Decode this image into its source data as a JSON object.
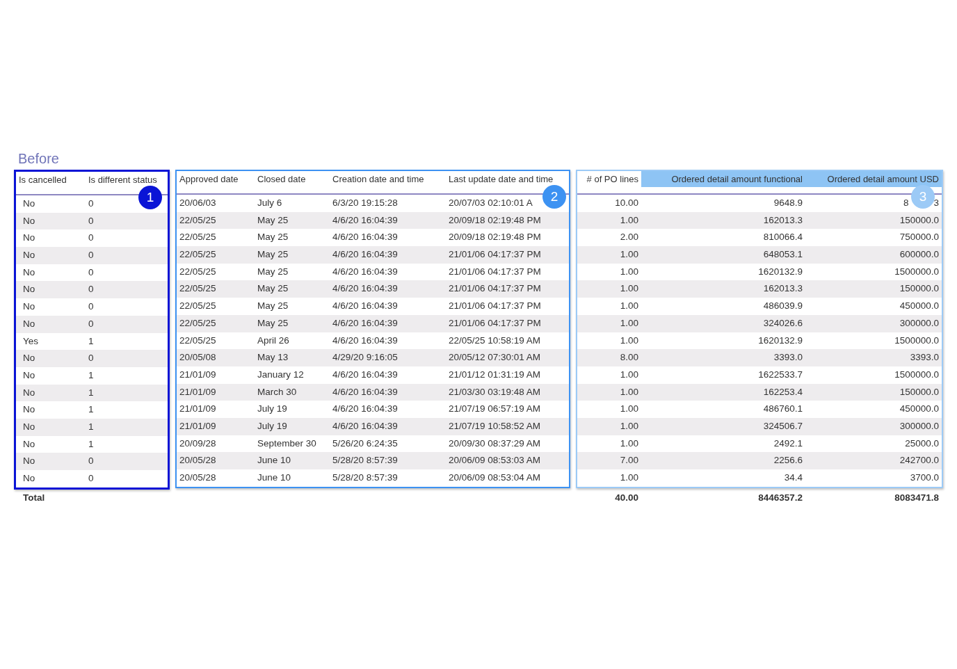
{
  "title": "Before",
  "groups": [
    {
      "badge": "1",
      "color": "#0a14d6",
      "kind": "text",
      "columns": [
        {
          "label": "Is cancelled",
          "highlighted": false
        },
        {
          "label": "Is different status",
          "highlighted": false
        }
      ]
    },
    {
      "badge": "2",
      "color": "#3d92f2",
      "kind": "text",
      "columns": [
        {
          "label": "Approved date",
          "highlighted": false
        },
        {
          "label": "Closed date",
          "highlighted": false
        },
        {
          "label": "Creation date and time",
          "highlighted": false
        },
        {
          "label": "Last update date and time",
          "highlighted": false
        }
      ]
    },
    {
      "badge": "3",
      "color": "#9ccaf6",
      "kind": "numeric",
      "columns": [
        {
          "label": "# of PO lines",
          "highlighted": false
        },
        {
          "label": "Ordered detail amount functional",
          "highlighted": true
        },
        {
          "label": "Ordered detail amount USD",
          "highlighted": true
        }
      ]
    }
  ],
  "rows": [
    {
      "cells": [
        "No",
        "0",
        "20/06/03",
        "July 6",
        "6/3/20 19:15:28",
        "20/07/03 02:10:01 A",
        "10.00",
        "9648.9",
        [
          "8",
          "3"
        ]
      ]
    },
    {
      "cells": [
        "No",
        "0",
        "22/05/25",
        "May 25",
        "4/6/20 16:04:39",
        "20/09/18 02:19:48 PM",
        "1.00",
        "162013.3",
        "150000.0"
      ]
    },
    {
      "cells": [
        "No",
        "0",
        "22/05/25",
        "May 25",
        "4/6/20 16:04:39",
        "20/09/18 02:19:48 PM",
        "2.00",
        "810066.4",
        "750000.0"
      ]
    },
    {
      "cells": [
        "No",
        "0",
        "22/05/25",
        "May 25",
        "4/6/20 16:04:39",
        "21/01/06 04:17:37 PM",
        "1.00",
        "648053.1",
        "600000.0"
      ]
    },
    {
      "cells": [
        "No",
        "0",
        "22/05/25",
        "May 25",
        "4/6/20 16:04:39",
        "21/01/06 04:17:37 PM",
        "1.00",
        "1620132.9",
        "1500000.0"
      ]
    },
    {
      "cells": [
        "No",
        "0",
        "22/05/25",
        "May 25",
        "4/6/20 16:04:39",
        "21/01/06 04:17:37 PM",
        "1.00",
        "162013.3",
        "150000.0"
      ]
    },
    {
      "cells": [
        "No",
        "0",
        "22/05/25",
        "May 25",
        "4/6/20 16:04:39",
        "21/01/06 04:17:37 PM",
        "1.00",
        "486039.9",
        "450000.0"
      ]
    },
    {
      "cells": [
        "No",
        "0",
        "22/05/25",
        "May 25",
        "4/6/20 16:04:39",
        "21/01/06 04:17:37 PM",
        "1.00",
        "324026.6",
        "300000.0"
      ]
    },
    {
      "cells": [
        "Yes",
        "1",
        "22/05/25",
        "April 26",
        "4/6/20 16:04:39",
        "22/05/25 10:58:19 AM",
        "1.00",
        "1620132.9",
        "1500000.0"
      ]
    },
    {
      "cells": [
        "No",
        "0",
        "20/05/08",
        "May 13",
        "4/29/20 9:16:05",
        "20/05/12 07:30:01 AM",
        "8.00",
        "3393.0",
        "3393.0"
      ]
    },
    {
      "cells": [
        "No",
        "1",
        "21/01/09",
        "January 12",
        "4/6/20 16:04:39",
        "21/01/12 01:31:19 AM",
        "1.00",
        "1622533.7",
        "1500000.0"
      ]
    },
    {
      "cells": [
        "No",
        "1",
        "21/01/09",
        "March 30",
        "4/6/20 16:04:39",
        "21/03/30 03:19:48 AM",
        "1.00",
        "162253.4",
        "150000.0"
      ]
    },
    {
      "cells": [
        "No",
        "1",
        "21/01/09",
        "July 19",
        "4/6/20 16:04:39",
        "21/07/19 06:57:19 AM",
        "1.00",
        "486760.1",
        "450000.0"
      ]
    },
    {
      "cells": [
        "No",
        "1",
        "21/01/09",
        "July 19",
        "4/6/20 16:04:39",
        "21/07/19 10:58:52 AM",
        "1.00",
        "324506.7",
        "300000.0"
      ]
    },
    {
      "cells": [
        "No",
        "1",
        "20/09/28",
        "September 30",
        "5/26/20 6:24:35",
        "20/09/30 08:37:29 AM",
        "1.00",
        "2492.1",
        "25000.0"
      ]
    },
    {
      "cells": [
        "No",
        "0",
        "20/05/28",
        "June 10",
        "5/28/20 8:57:39",
        "20/06/09 08:53:03 AM",
        "7.00",
        "2256.6",
        "242700.0"
      ]
    },
    {
      "cells": [
        "No",
        "0",
        "20/05/28",
        "June 10",
        "5/28/20 8:57:39",
        "20/06/09 08:53:04 AM",
        "1.00",
        "34.4",
        "3700.0"
      ]
    }
  ],
  "total": {
    "label": "Total",
    "values": [
      "40.00",
      "8446357.2",
      "8083471.8"
    ]
  }
}
